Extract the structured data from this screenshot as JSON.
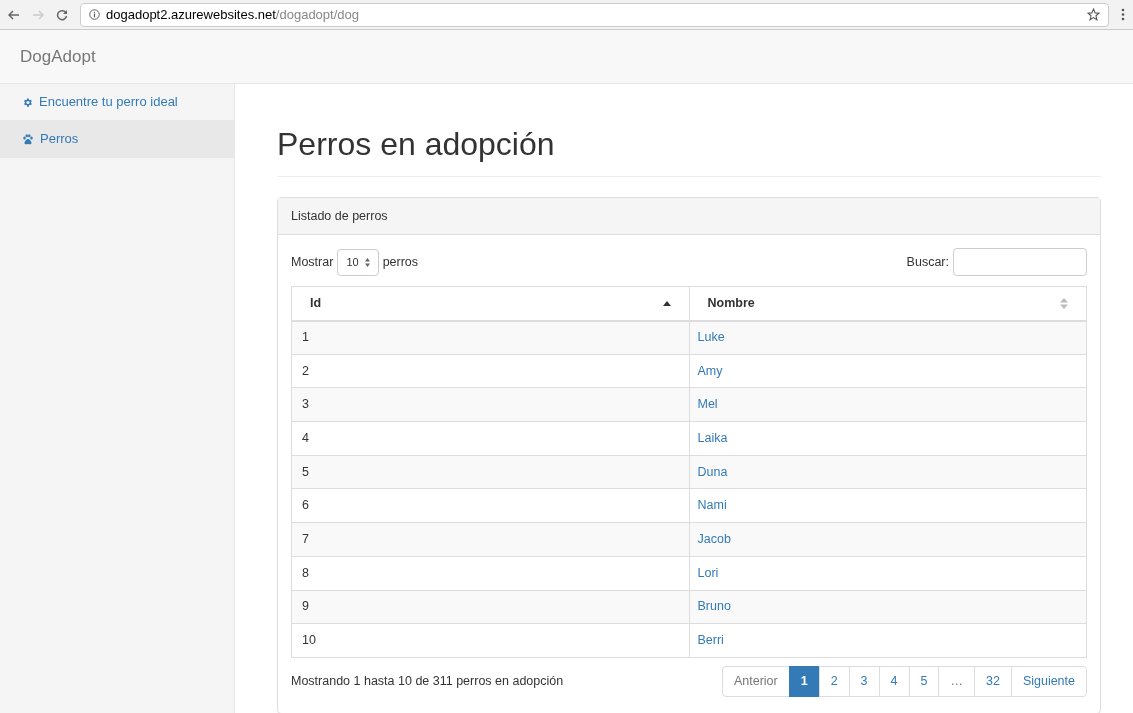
{
  "browser": {
    "url_host": "dogadopt2.azurewebsites.net",
    "url_path": "/dogadopt/dog"
  },
  "navbar": {
    "brand": "DogAdopt"
  },
  "sidebar": {
    "items": [
      {
        "label": "Encuentre tu perro ideal",
        "selected": false
      },
      {
        "label": "Perros",
        "selected": true
      }
    ]
  },
  "page": {
    "title": "Perros en adopción"
  },
  "panel": {
    "heading": "Listado de perros",
    "length": {
      "before": "Mostrar",
      "value": "10",
      "after": "perros"
    },
    "search": {
      "label": "Buscar:"
    },
    "table": {
      "columns": [
        {
          "label": "Id",
          "sorted": true
        },
        {
          "label": "Nombre",
          "sorted": false
        }
      ],
      "rows": [
        [
          "1",
          "Luke"
        ],
        [
          "2",
          "Amy"
        ],
        [
          "3",
          "Mel"
        ],
        [
          "4",
          "Laika"
        ],
        [
          "5",
          "Duna"
        ],
        [
          "6",
          "Nami"
        ],
        [
          "7",
          "Jacob"
        ],
        [
          "8",
          "Lori"
        ],
        [
          "9",
          "Bruno"
        ],
        [
          "10",
          "Berri"
        ]
      ]
    },
    "info": "Mostrando 1 hasta 10 de 311 perros en adopción",
    "pagination": [
      {
        "label": "Anterior",
        "disabled": true,
        "selected": false
      },
      {
        "label": "1",
        "disabled": false,
        "selected": true
      },
      {
        "label": "2",
        "disabled": false,
        "selected": false
      },
      {
        "label": "3",
        "disabled": false,
        "selected": false
      },
      {
        "label": "4",
        "disabled": false,
        "selected": false
      },
      {
        "label": "5",
        "disabled": false,
        "selected": false
      },
      {
        "label": "…",
        "disabled": true,
        "selected": false
      },
      {
        "label": "32",
        "disabled": false,
        "selected": false
      },
      {
        "label": "Siguiente",
        "disabled": false,
        "selected": false
      }
    ]
  }
}
